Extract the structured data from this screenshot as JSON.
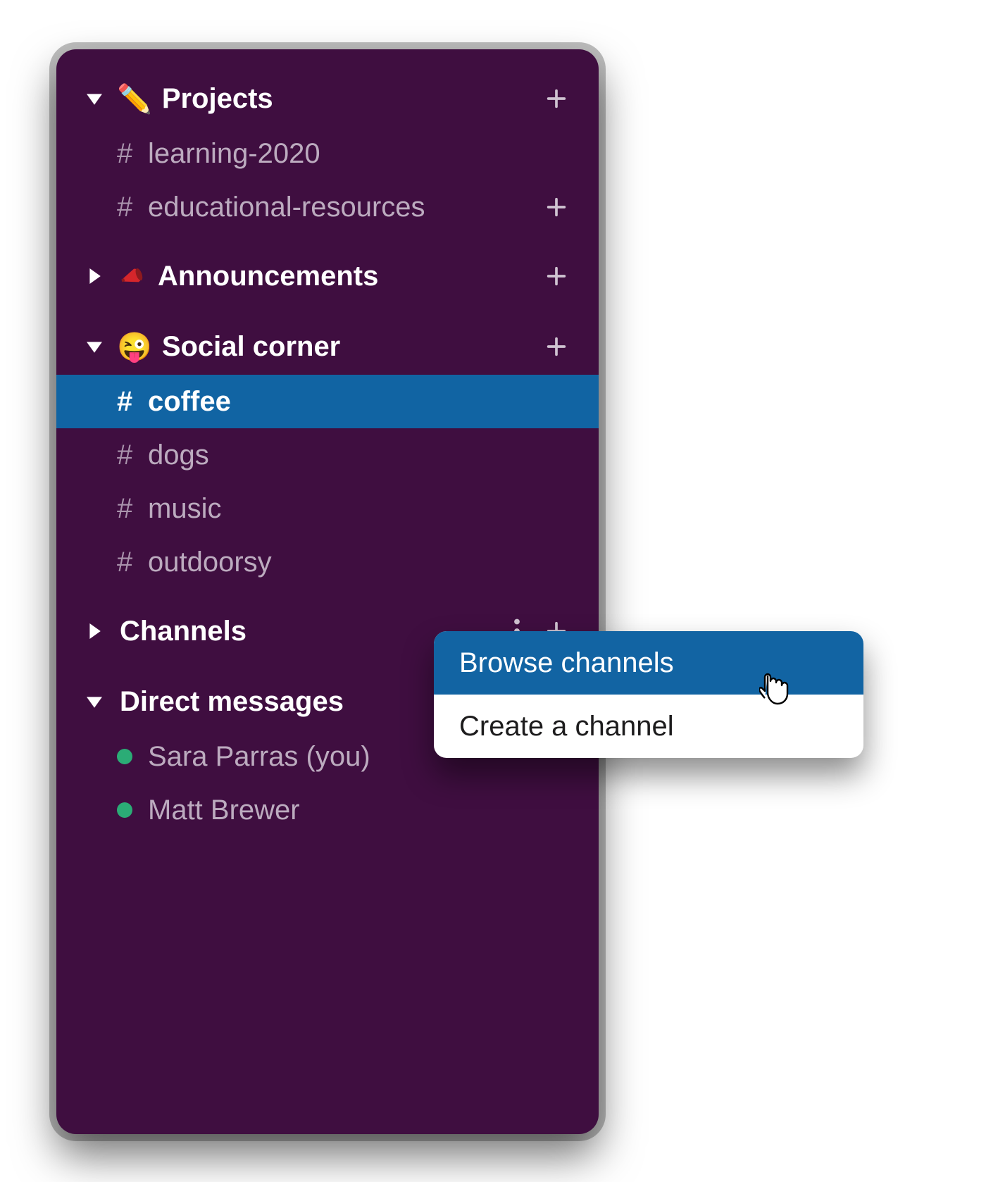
{
  "sidebar": {
    "sections": [
      {
        "id": "projects",
        "label": "Projects",
        "emoji": "✏️",
        "expanded": true,
        "show_add": true,
        "channels": [
          {
            "name": "learning-2020",
            "active": false,
            "show_add": false
          },
          {
            "name": "educational-resources",
            "active": false,
            "show_add": true
          }
        ]
      },
      {
        "id": "announcements",
        "label": "Announcements",
        "emoji": "📣",
        "expanded": false,
        "show_add": true,
        "channels": []
      },
      {
        "id": "social-corner",
        "label": "Social corner",
        "emoji": "😜",
        "expanded": true,
        "show_add": true,
        "channels": [
          {
            "name": "coffee",
            "active": true,
            "show_add": false
          },
          {
            "name": "dogs",
            "active": false,
            "show_add": false
          },
          {
            "name": "music",
            "active": false,
            "show_add": false
          },
          {
            "name": "outdoorsy",
            "active": false,
            "show_add": false
          }
        ]
      },
      {
        "id": "channels",
        "label": "Channels",
        "emoji": "",
        "expanded": false,
        "show_add": true,
        "show_more": true,
        "channels": []
      },
      {
        "id": "dms",
        "label": "Direct messages",
        "emoji": "",
        "expanded": true,
        "show_add": true,
        "dms": [
          {
            "name": "Sara Parras (you)",
            "presence": "active"
          },
          {
            "name": "Matt Brewer",
            "presence": "active"
          }
        ]
      }
    ]
  },
  "popover": {
    "items": [
      {
        "label": "Browse channels",
        "highlighted": true
      },
      {
        "label": "Create a channel",
        "highlighted": false
      }
    ]
  },
  "colors": {
    "sidebar_bg": "#3f0e40",
    "active_bg": "#1164a3",
    "popover_highlight": "#1264a3",
    "presence_active": "#2bac76"
  }
}
